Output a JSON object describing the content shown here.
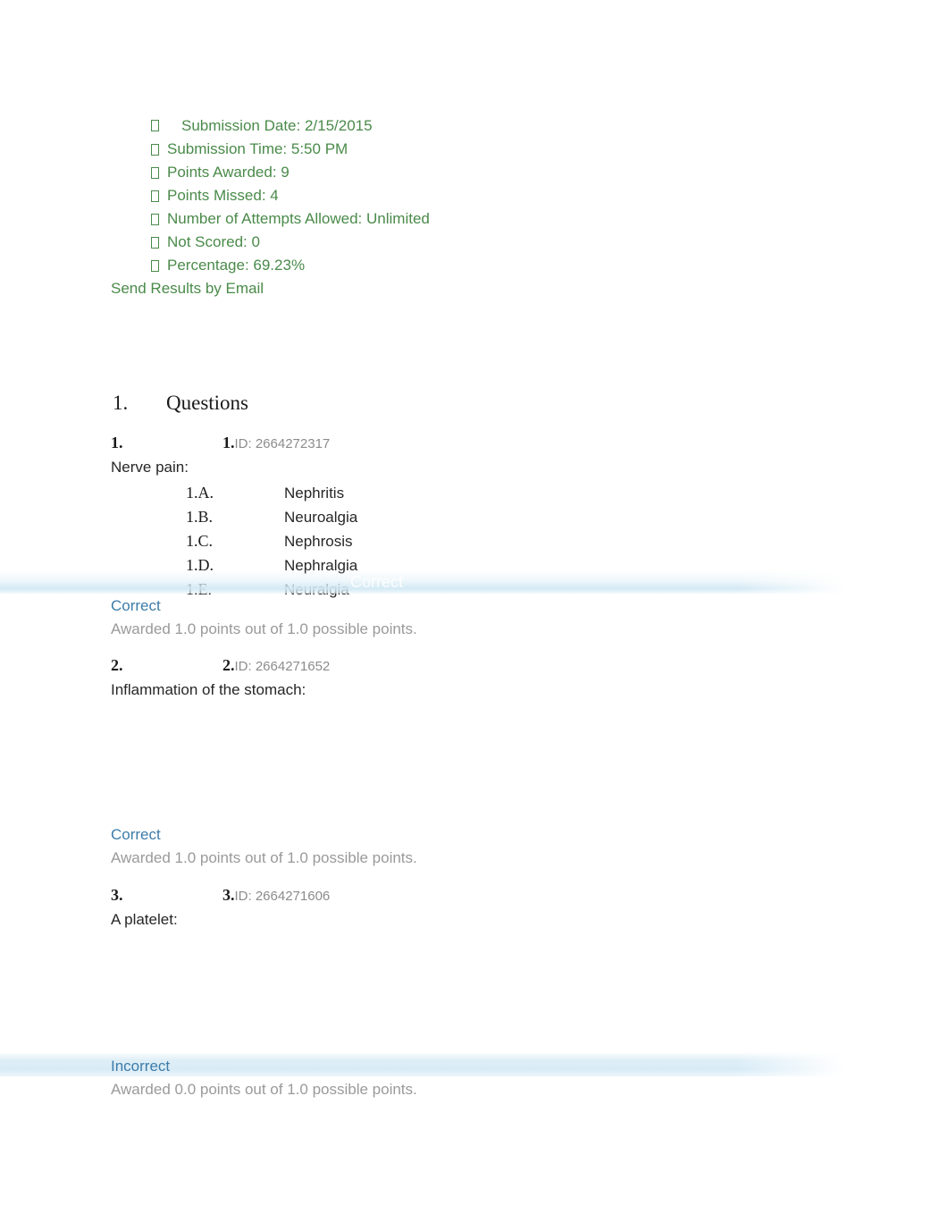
{
  "summary": {
    "bullet_glyph": "missing-glyph-box",
    "color": "#4a8a4a",
    "rows": [
      {
        "id": "submission-date",
        "label": "Submission Date: 2/15/2015",
        "bullet": false,
        "leading_box": true
      },
      {
        "id": "submission-time",
        "label": "Submission Time: 5:50 PM",
        "bullet": true,
        "leading_box": false
      },
      {
        "id": "points-awarded",
        "label": "Points Awarded: 9",
        "bullet": true,
        "leading_box": false
      },
      {
        "id": "points-missed",
        "label": "Points Missed: 4",
        "bullet": true,
        "leading_box": false
      },
      {
        "id": "attempts-allowed",
        "label": "Number of Attempts Allowed: Unlimited",
        "bullet": true,
        "leading_box": false
      },
      {
        "id": "not-scored",
        "label": "Not Scored: 0",
        "bullet": true,
        "leading_box": false
      },
      {
        "id": "percentage",
        "label": "Percentage: 69.23%",
        "bullet": true,
        "leading_box": false
      }
    ],
    "send_results_link": "Send Results by Email"
  },
  "questions_section": {
    "number": "1.",
    "title": "Questions"
  },
  "questions": [
    {
      "outer_number": "1.",
      "inner_number": "1.",
      "id_label": "ID: 2664272317",
      "stem": "Nerve pain:",
      "options": [
        {
          "marker": "1.A.",
          "text": "Nephritis"
        },
        {
          "marker": "1.B.",
          "text": "Neuroalgia"
        },
        {
          "marker": "1.C.",
          "text": "Nephrosis"
        },
        {
          "marker": "1.D.",
          "text": "Nephralgia"
        },
        {
          "marker": "1.E.",
          "text": "Neuralgia"
        }
      ],
      "ghost_label": "Correct",
      "result_status": "Correct",
      "result_points": "Awarded 1.0 points out of 1.0 possible points."
    },
    {
      "outer_number": "2.",
      "inner_number": "2.",
      "id_label": "ID: 2664271652",
      "stem": "Inflammation of the stomach:",
      "options": [],
      "ghost_label": "",
      "result_status": "Correct",
      "result_points": "Awarded 1.0 points out of 1.0 possible points."
    },
    {
      "outer_number": "3.",
      "inner_number": "3.",
      "id_label": "ID: 2664271606",
      "stem": "A platelet:",
      "options": [],
      "ghost_label": "",
      "result_status": "Incorrect",
      "result_points": "Awarded 0.0 points out of 1.0 possible points."
    }
  ],
  "colors": {
    "green_text": "#4a8a4a",
    "status_blue": "#3d7ca8",
    "points_grey": "#9a9a9a",
    "highlight_band": "#d8ebf6",
    "body_text": "#262626"
  }
}
